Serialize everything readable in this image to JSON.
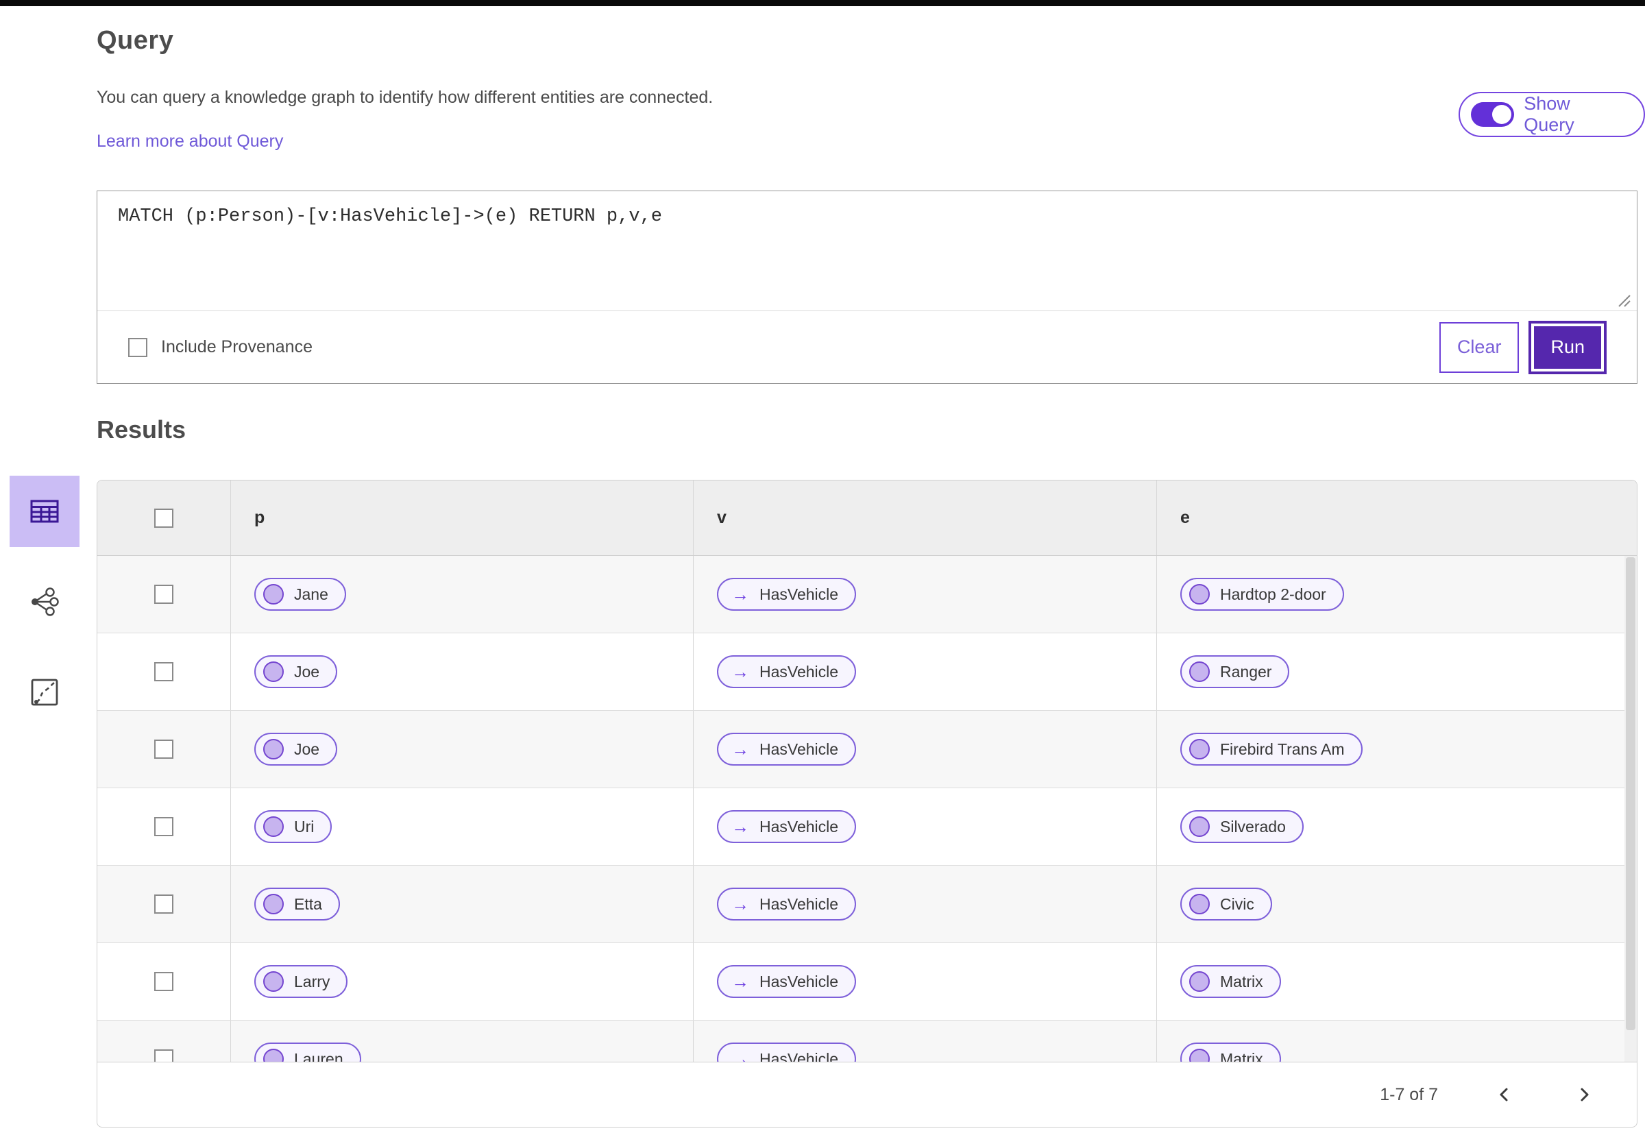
{
  "page": {
    "title": "Query",
    "description": "You can query a knowledge graph to identify how different entities are connected.",
    "learn_more": "Learn more about Query"
  },
  "toggle": {
    "label": "Show Query",
    "state": "on"
  },
  "query_editor": {
    "text": "MATCH (p:Person)-[v:HasVehicle]->(e) RETURN p,v,e",
    "include_provenance_label": "Include Provenance",
    "include_provenance_checked": false,
    "clear_label": "Clear",
    "run_label": "Run"
  },
  "view_rail": {
    "items": [
      {
        "icon": "table-view-icon",
        "selected": true
      },
      {
        "icon": "graph-view-icon",
        "selected": false
      },
      {
        "icon": "map-view-icon",
        "selected": false
      }
    ]
  },
  "results": {
    "heading": "Results",
    "columns": {
      "0": "p",
      "1": "v",
      "2": "e"
    },
    "v_arrow_icon": "→",
    "rows": [
      {
        "p": "Jane",
        "v": "HasVehicle",
        "e": "Hardtop 2-door"
      },
      {
        "p": "Joe",
        "v": "HasVehicle",
        "e": "Ranger"
      },
      {
        "p": "Joe",
        "v": "HasVehicle",
        "e": "Firebird Trans Am"
      },
      {
        "p": "Uri",
        "v": "HasVehicle",
        "e": "Silverado"
      },
      {
        "p": "Etta",
        "v": "HasVehicle",
        "e": "Civic"
      },
      {
        "p": "Larry",
        "v": "HasVehicle",
        "e": "Matrix"
      },
      {
        "p": "Lauren",
        "v": "HasVehicle",
        "e": "Matrix"
      }
    ],
    "pagination": {
      "range_label": "1-7 of 7"
    }
  },
  "colors": {
    "accent_purple": "#6a3ce0",
    "run_button_purple": "#5527ad",
    "toggle_purple": "#6330d8",
    "pill_border": "#7e60da",
    "pill_background": "#f7f5fe",
    "pill_circle_fill": "#c7b4ef",
    "link_purple": "#6f59d8",
    "selected_rail_background": "#cbbdf5",
    "selected_rail_icon": "#3a1795",
    "table_header_background": "#eeeeee",
    "row_alt_background": "#f7f7f7"
  }
}
